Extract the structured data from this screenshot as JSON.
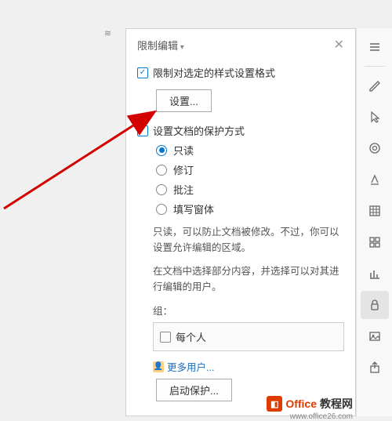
{
  "panel": {
    "title": "限制编辑",
    "close_tooltip": "关闭",
    "section1": {
      "checkbox_label": "限制对选定的样式设置格式",
      "settings_btn": "设置..."
    },
    "section2": {
      "checkbox_label": "设置文档的保护方式",
      "radios": {
        "readonly": "只读",
        "revision": "修订",
        "comment": "批注",
        "form": "填写窗体"
      },
      "desc1": "只读，可以防止文档被修改。不过，你可以设置允许编辑的区域。",
      "desc2": "在文档中选择部分内容，并选择可以对其进行编辑的用户。",
      "group_label": "组：",
      "everyone": "每个人",
      "more_users": "更多用户...",
      "start_protection": "启动保护..."
    }
  },
  "rail": {
    "menu": "菜单",
    "pen": "画笔",
    "select": "选择",
    "badge": "徽章",
    "highlight": "高亮",
    "table": "表格",
    "grid": "网格",
    "chart": "图表",
    "lock": "保护",
    "image": "图片",
    "share": "分享"
  },
  "watermark": {
    "brand1": "Office",
    "brand2": "教程网",
    "url": "www.office26.com"
  }
}
